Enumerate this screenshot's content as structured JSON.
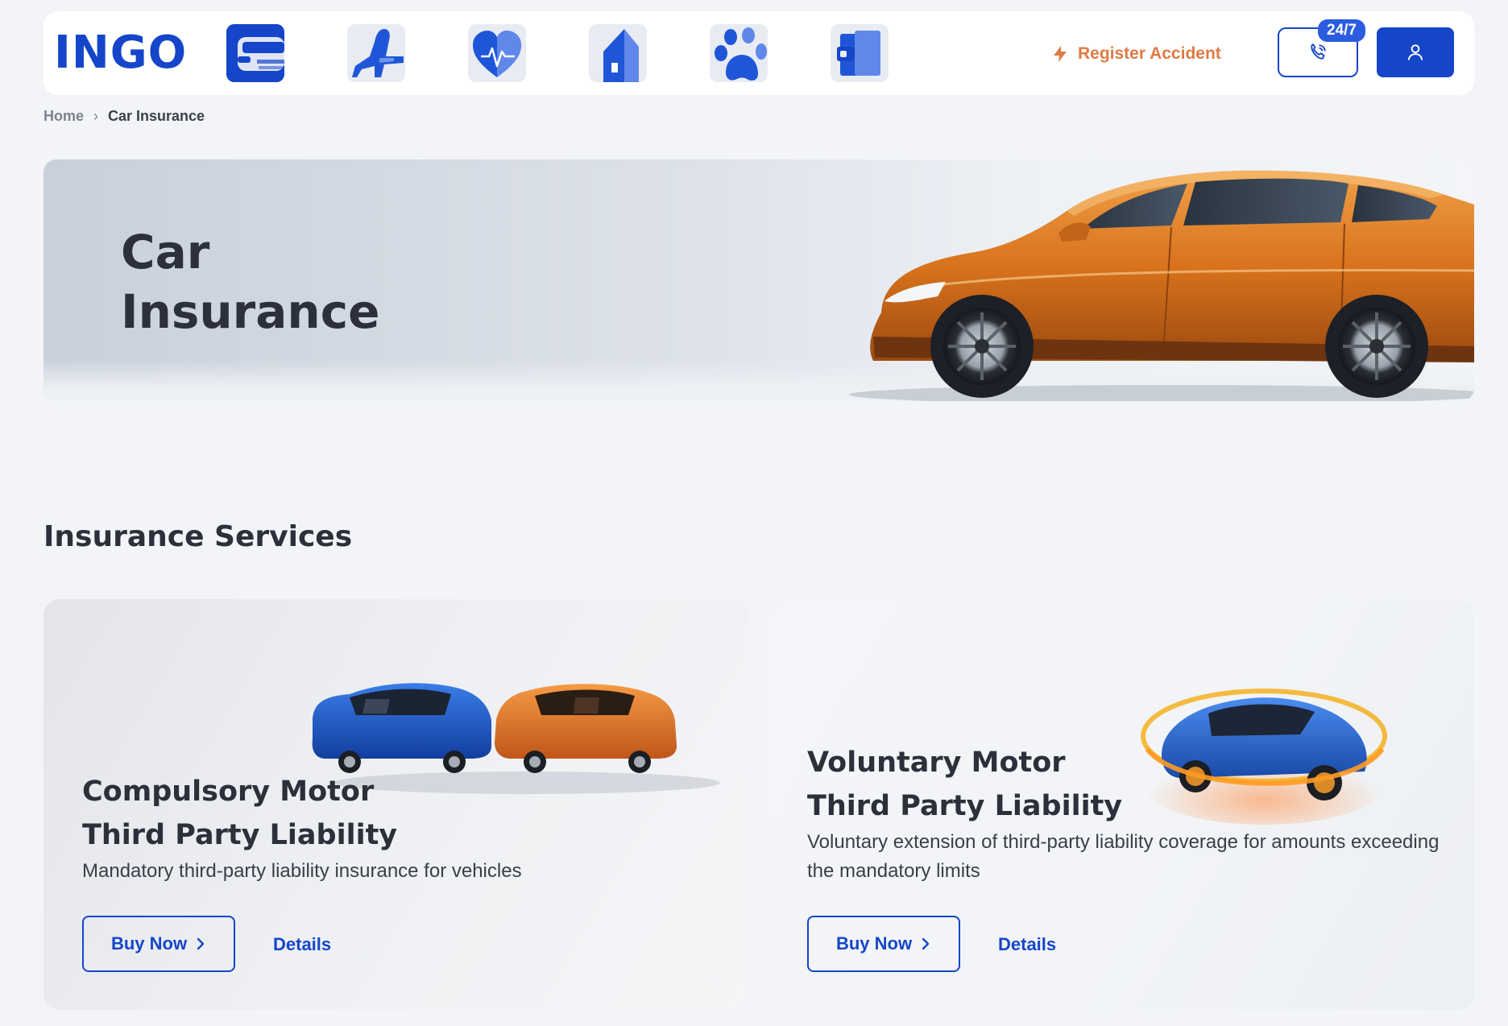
{
  "header": {
    "logo": "INGO",
    "categories": [
      {
        "name": "car",
        "icon": "car-icon"
      },
      {
        "name": "travel",
        "icon": "airplane-icon"
      },
      {
        "name": "health",
        "icon": "heart-pulse-icon"
      },
      {
        "name": "property",
        "icon": "house-icon"
      },
      {
        "name": "pet",
        "icon": "paw-icon"
      },
      {
        "name": "wallet",
        "icon": "wallet-icon"
      }
    ],
    "register_accident": "Register Accident",
    "call_badge": "24/7",
    "accent_color": "#1546c9",
    "register_color": "#e07a45"
  },
  "breadcrumb": {
    "home": "Home",
    "separator": "›",
    "current": "Car Insurance"
  },
  "hero": {
    "title_line1": "Car",
    "title_line2": "Insurance"
  },
  "section": {
    "title": "Insurance Services"
  },
  "cards": [
    {
      "title_line1": "Compulsory Motor",
      "title_line2": "Third Party Liability",
      "description": "Mandatory third-party liability insurance for vehicles",
      "buy_label": "Buy Now",
      "details_label": "Details"
    },
    {
      "title_line1": "Voluntary Motor",
      "title_line2": "Third Party Liability",
      "description": "Voluntary extension of third-party liability coverage for amounts exceeding the mandatory limits",
      "buy_label": "Buy Now",
      "details_label": "Details"
    }
  ]
}
